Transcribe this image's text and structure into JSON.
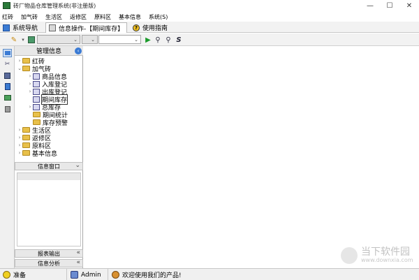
{
  "window": {
    "title": "砖厂物品仓库管理系统(非注册版)",
    "buttons": [
      "—",
      "☐",
      "✕"
    ]
  },
  "menubar": [
    "红砖",
    "加气砖",
    "生活区",
    "返修区",
    "原料区",
    "基本信息",
    "系统(S)"
  ],
  "tabs": [
    {
      "label": "系统导航"
    },
    {
      "label": "信息操作-【期间库存】"
    },
    {
      "label": "使用指南"
    }
  ],
  "panel": {
    "title": "管理信息",
    "tree": [
      {
        "label": "红砖",
        "level": 0,
        "type": "folder",
        "expander": "›"
      },
      {
        "label": "加气砖",
        "level": 0,
        "type": "folder",
        "expander": "⌄"
      },
      {
        "label": "商品信息",
        "level": 1,
        "type": "item",
        "expander": "›"
      },
      {
        "label": "入库登记",
        "level": 1,
        "type": "item",
        "expander": "›"
      },
      {
        "label": "出库登记",
        "level": 1,
        "type": "item",
        "expander": "›"
      },
      {
        "label": "期间库存",
        "level": 1,
        "type": "item",
        "expander": "",
        "selected": true
      },
      {
        "label": "总库存",
        "level": 1,
        "type": "item",
        "expander": "›"
      },
      {
        "label": "期间统计",
        "level": 1,
        "type": "folder",
        "expander": ""
      },
      {
        "label": "库存预警",
        "level": 1,
        "type": "folder",
        "expander": ""
      },
      {
        "label": "生活区",
        "level": 0,
        "type": "folder",
        "expander": "›"
      },
      {
        "label": "返修区",
        "level": 0,
        "type": "folder",
        "expander": "›"
      },
      {
        "label": "原料区",
        "level": 0,
        "type": "folder",
        "expander": "›"
      },
      {
        "label": "基本信息",
        "level": 0,
        "type": "folder",
        "expander": "›"
      }
    ],
    "sections": [
      {
        "label": "信息窗口",
        "chevron": "⌄"
      },
      {
        "label": "报表输出",
        "chevron": "«"
      },
      {
        "label": "信息分析",
        "chevron": "«"
      }
    ]
  },
  "statusbar": {
    "status": "准备",
    "user": "Admin",
    "message": "欢迎使用我们的产品!"
  },
  "watermark": {
    "title": "当下软件园",
    "url": "www.downxia.com"
  },
  "colors": {
    "folder": "#e8c04a",
    "accent": "#3b7bd4",
    "run": "#1a9a2a"
  }
}
